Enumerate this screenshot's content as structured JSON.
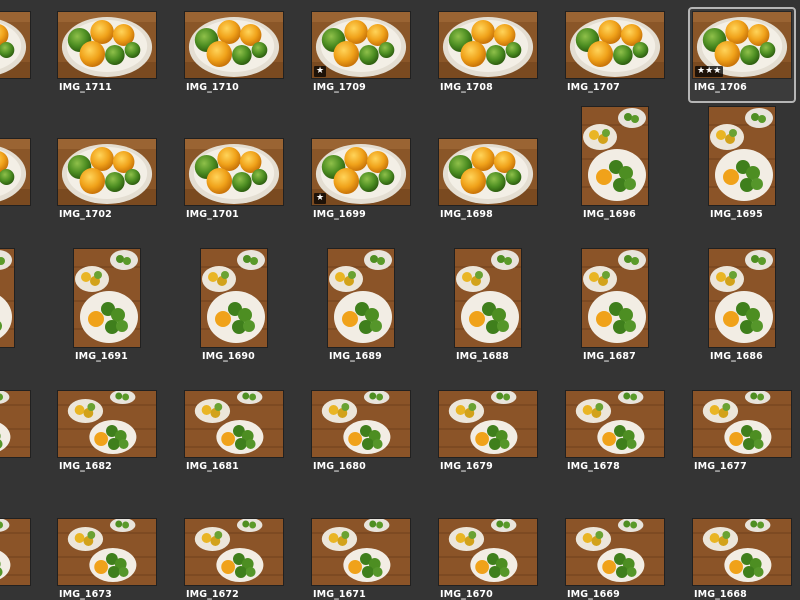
{
  "selected_photo": "IMG_1706",
  "rows": [
    {
      "items": [
        {
          "name": "",
          "kind": "fruit_l"
        },
        {
          "name": "IMG_1711",
          "kind": "fruit_l"
        },
        {
          "name": "IMG_1710",
          "kind": "fruit_l"
        },
        {
          "name": "IMG_1709",
          "kind": "fruit_l",
          "rating": "★"
        },
        {
          "name": "IMG_1708",
          "kind": "fruit_l"
        },
        {
          "name": "IMG_1707",
          "kind": "fruit_l"
        },
        {
          "name": "IMG_1706",
          "kind": "fruit_l",
          "rating": "★★★",
          "selected": true
        }
      ]
    },
    {
      "items": [
        {
          "name": "",
          "kind": "fruit_l"
        },
        {
          "name": "IMG_1702",
          "kind": "fruit_l"
        },
        {
          "name": "IMG_1701",
          "kind": "fruit_l"
        },
        {
          "name": "IMG_1699",
          "kind": "fruit_l",
          "rating": "★"
        },
        {
          "name": "IMG_1698",
          "kind": "fruit_l"
        },
        {
          "name": "IMG_1696",
          "kind": "table_p"
        },
        {
          "name": "IMG_1695",
          "kind": "table_p"
        }
      ]
    },
    {
      "items": [
        {
          "name": "",
          "kind": "table_p"
        },
        {
          "name": "IMG_1691",
          "kind": "table_p"
        },
        {
          "name": "IMG_1690",
          "kind": "table_p"
        },
        {
          "name": "IMG_1689",
          "kind": "table_p"
        },
        {
          "name": "IMG_1688",
          "kind": "table_p"
        },
        {
          "name": "IMG_1687",
          "kind": "table_p"
        },
        {
          "name": "IMG_1686",
          "kind": "table_p"
        }
      ]
    },
    {
      "items": [
        {
          "name": "",
          "kind": "table_l"
        },
        {
          "name": "IMG_1682",
          "kind": "table_l"
        },
        {
          "name": "IMG_1681",
          "kind": "table_l"
        },
        {
          "name": "IMG_1680",
          "kind": "table_l"
        },
        {
          "name": "IMG_1679",
          "kind": "table_l"
        },
        {
          "name": "IMG_1678",
          "kind": "table_l"
        },
        {
          "name": "IMG_1677",
          "kind": "table_l"
        }
      ]
    },
    {
      "items": [
        {
          "name": "",
          "kind": "table_l"
        },
        {
          "name": "IMG_1673",
          "kind": "table_l"
        },
        {
          "name": "IMG_1672",
          "kind": "table_l"
        },
        {
          "name": "IMG_1671",
          "kind": "table_l"
        },
        {
          "name": "IMG_1670",
          "kind": "table_l"
        },
        {
          "name": "IMG_1669",
          "kind": "table_l"
        },
        {
          "name": "IMG_1668",
          "kind": "table_l"
        }
      ]
    }
  ]
}
